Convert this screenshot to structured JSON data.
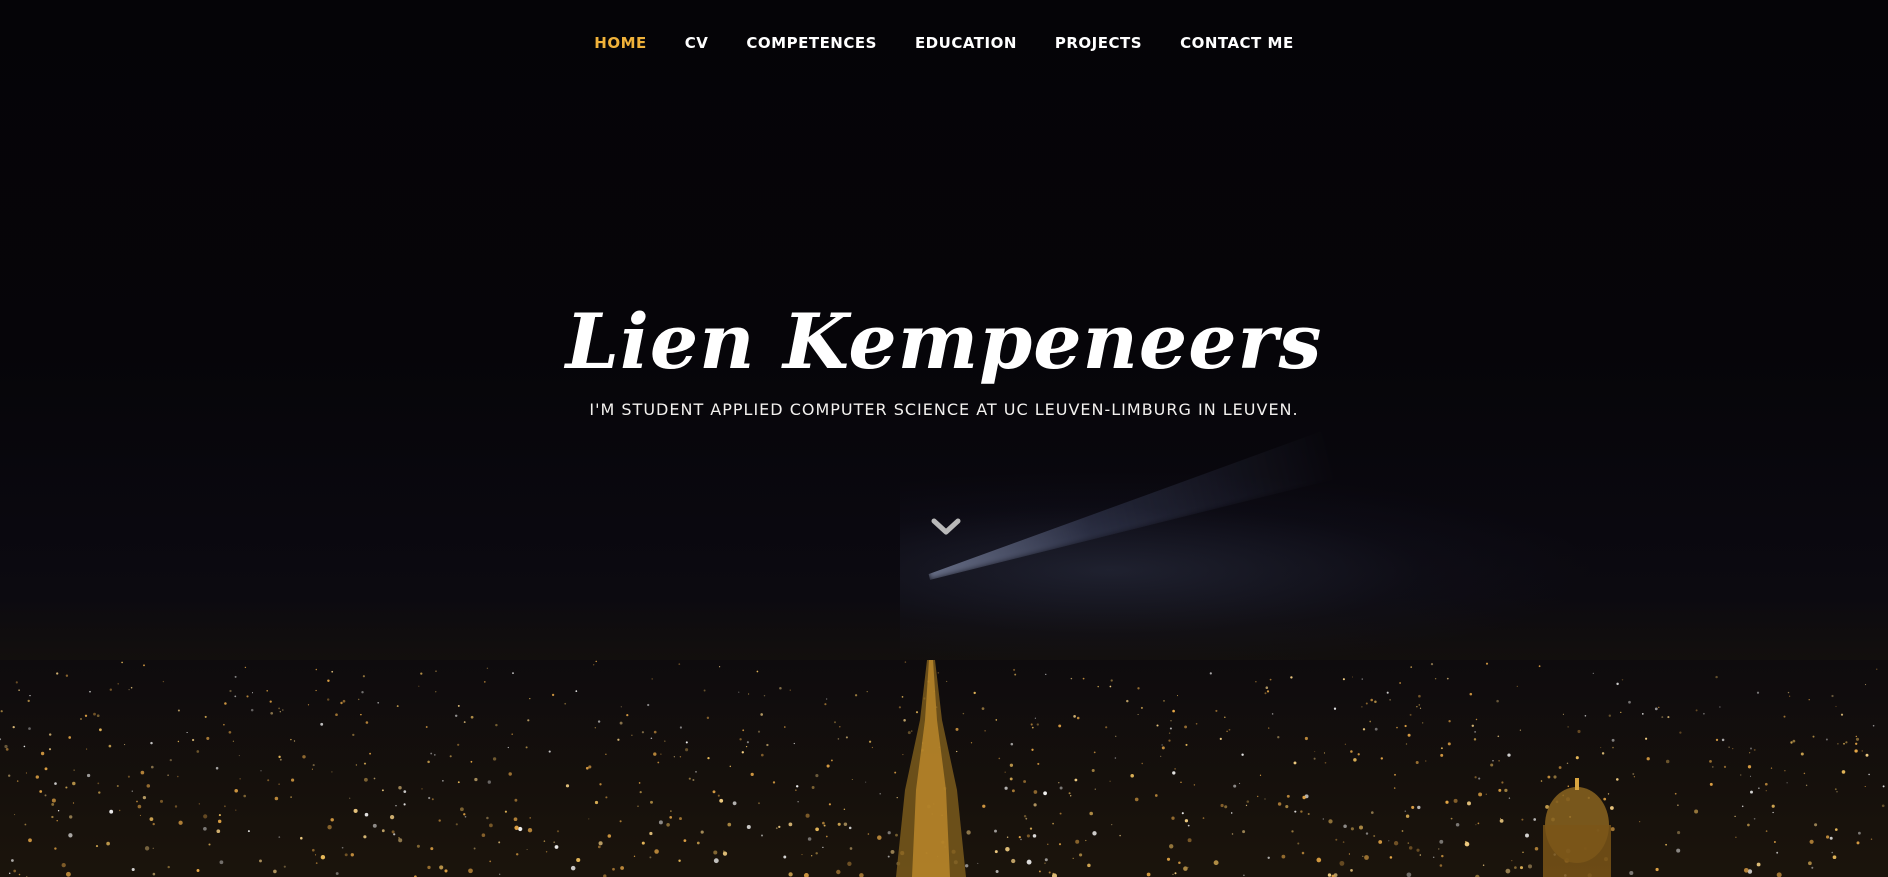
{
  "nav": {
    "items": [
      {
        "label": "HOME",
        "active": true
      },
      {
        "label": "CV",
        "active": false
      },
      {
        "label": "COMPETENCES",
        "active": false
      },
      {
        "label": "EDUCATION",
        "active": false
      },
      {
        "label": "PROJECTS",
        "active": false
      },
      {
        "label": "CONTACT ME",
        "active": false
      }
    ],
    "active_color": "#f0b23a"
  },
  "hero": {
    "title": "Lien Kempeneers",
    "subtitle": "I'M STUDENT APPLIED COMPUTER SCIENCE AT UC LEUVEN-LIMBURG IN LEUVEN.",
    "scroll_icon": "chevron-down-icon"
  },
  "background": {
    "image": "paris-night-skyline-with-eiffel-tower"
  }
}
